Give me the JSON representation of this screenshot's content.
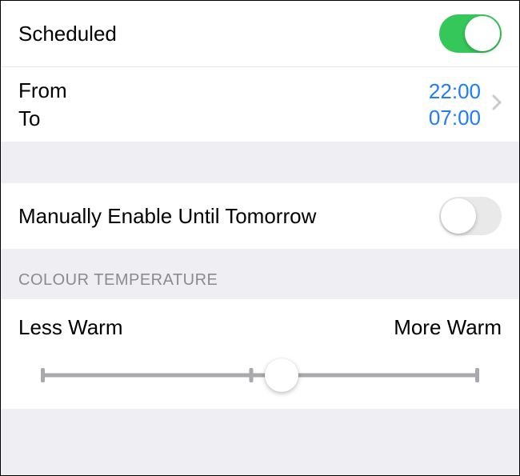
{
  "scheduled": {
    "label": "Scheduled",
    "enabled": true,
    "from_label": "From",
    "to_label": "To",
    "from_time": "22:00",
    "to_time": "07:00"
  },
  "manual": {
    "label": "Manually Enable Until Tomorrow",
    "enabled": false
  },
  "temperature": {
    "header": "COLOUR TEMPERATURE",
    "less_label": "Less Warm",
    "more_label": "More Warm",
    "value_percent": 55,
    "tick_percent": 48
  },
  "colors": {
    "accent_link": "#1f7bff",
    "toggle_on": "#35c759"
  }
}
